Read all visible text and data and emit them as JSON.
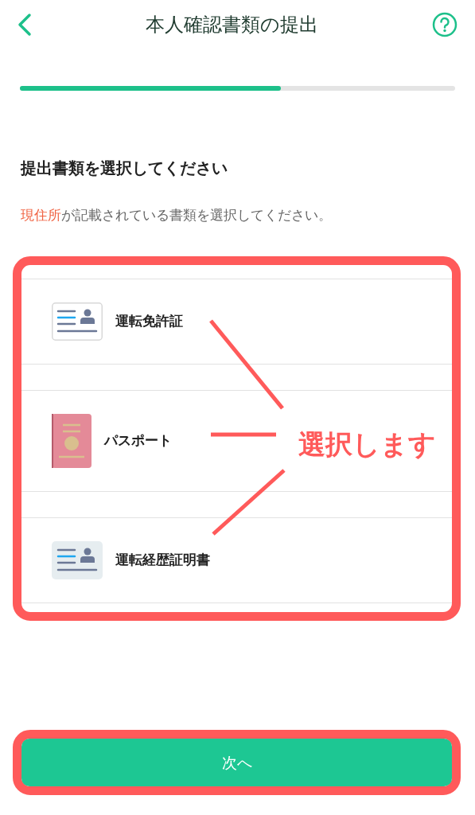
{
  "header": {
    "title": "本人確認書類の提出"
  },
  "progress": {
    "level": 0.6
  },
  "heading": "提出書類を選択してください",
  "description": [
    {
      "text": "現住所",
      "highlight": true
    },
    {
      "text": "が記載されている書類を選択してください。",
      "highlight": false
    }
  ],
  "documents": [
    {
      "label": "運転免許証",
      "kind": "license"
    },
    {
      "label": "パスポート",
      "kind": "passport"
    },
    {
      "label": "運転経歴証明書",
      "kind": "history"
    }
  ],
  "annotation": {
    "text": "選択します"
  },
  "next_button": {
    "label": "次へ"
  }
}
